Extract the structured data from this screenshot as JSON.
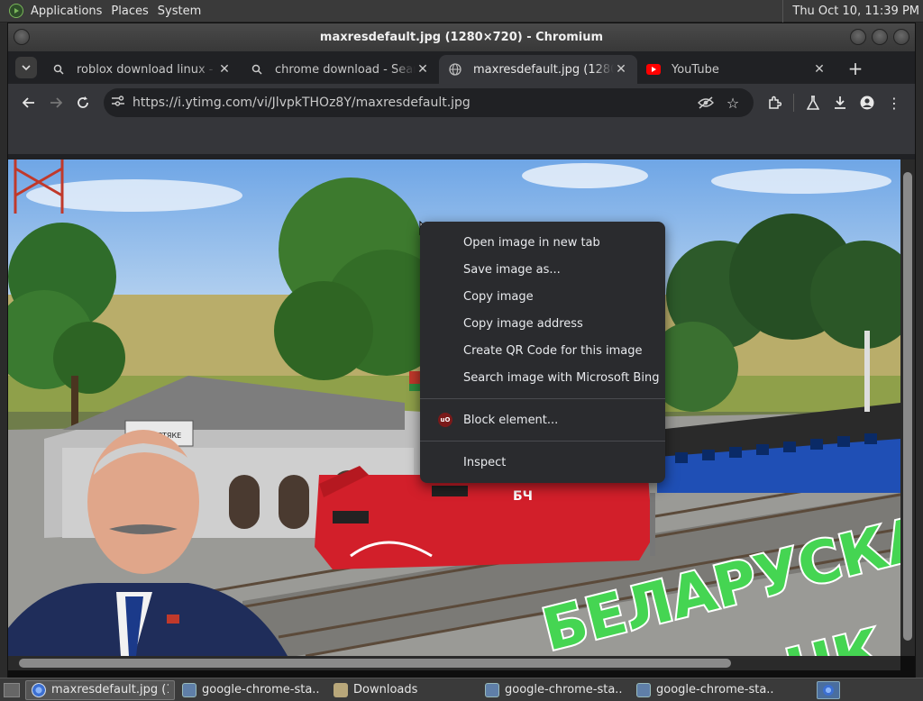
{
  "topbar": {
    "menus": [
      "Applications",
      "Places",
      "System"
    ],
    "clock": "Thu Oct 10, 11:39 PM"
  },
  "window": {
    "title": "maxresdefault.jpg (1280×720) - Chromium"
  },
  "tabs": [
    {
      "title": "roblox download linux - Se",
      "favicon": "search-favicon"
    },
    {
      "title": "chrome download - Searc",
      "favicon": "search-favicon"
    },
    {
      "title": "maxresdefault.jpg (1280×",
      "favicon": "globe-favicon",
      "active": true
    },
    {
      "title": "YouTube",
      "favicon": "youtube-favicon"
    }
  ],
  "omnibox": {
    "url": "https://i.ytimg.com/vi/JlvpkTHOz8Y/maxresdefault.jpg"
  },
  "context_menu": {
    "items": [
      "Open image in new tab",
      "Save image as...",
      "Copy image",
      "Copy image address",
      "Create QR Code for this image",
      "Search image with Microsoft Bing"
    ],
    "extension_item": "Block element...",
    "extension_badge": "uO",
    "inspect": "Inspect"
  },
  "image": {
    "station_sign": "РЕЙ ПРТЯКЕ",
    "overlay_line1": "БЕЛАРУСКА",
    "overlay_line2": "НК",
    "locomotive_badge": "БЧ"
  },
  "taskbar": {
    "tasks": [
      {
        "label": "maxresdefault.jpg (1...",
        "icon": "chromium-icon",
        "active": true
      },
      {
        "label": "google-chrome-sta...",
        "icon": "package-icon"
      },
      {
        "label": "Downloads",
        "icon": "folder-icon"
      },
      {
        "label": "google-chrome-sta...",
        "icon": "package-icon"
      },
      {
        "label": "google-chrome-sta...",
        "icon": "package-icon"
      }
    ]
  },
  "colors": {
    "accent": "#8ab4f8",
    "youtube_red": "#ff0000",
    "menu_bg": "#2a2b2e"
  }
}
